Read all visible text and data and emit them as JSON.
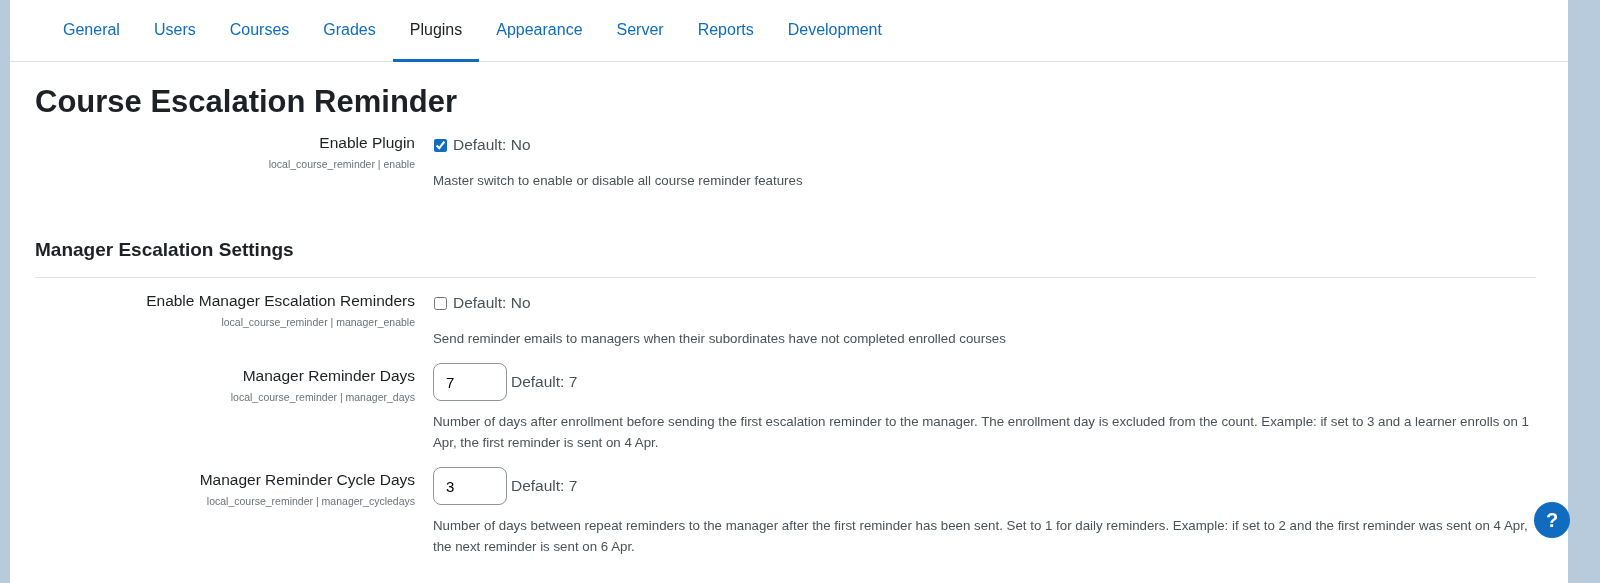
{
  "tabs": [
    {
      "label": "General",
      "selected": false
    },
    {
      "label": "Users",
      "selected": false
    },
    {
      "label": "Courses",
      "selected": false
    },
    {
      "label": "Grades",
      "selected": false
    },
    {
      "label": "Plugins",
      "selected": true
    },
    {
      "label": "Appearance",
      "selected": false
    },
    {
      "label": "Server",
      "selected": false
    },
    {
      "label": "Reports",
      "selected": false
    },
    {
      "label": "Development",
      "selected": false
    }
  ],
  "page_title": "Course Escalation Reminder",
  "sections": [
    {
      "settings": [
        {
          "kind": "checkbox",
          "label": "Enable Plugin",
          "key": "local_course_reminder | enable",
          "checked": true,
          "default": "Default: No",
          "description": "Master switch to enable or disable all course reminder features"
        }
      ]
    },
    {
      "heading": "Manager Escalation Settings",
      "settings": [
        {
          "kind": "checkbox",
          "label": "Enable Manager Escalation Reminders",
          "key": "local_course_reminder | manager_enable",
          "checked": false,
          "default": "Default: No",
          "description": "Send reminder emails to managers when their subordinates have not completed enrolled courses"
        },
        {
          "kind": "text",
          "label": "Manager Reminder Days",
          "key": "local_course_reminder | manager_days",
          "value": "7",
          "default": "Default: 7",
          "description": "Number of days after enrollment before sending the first escalation reminder to the manager. The enrollment day is excluded from the count. Example: if set to 3 and a learner enrolls on 1 Apr, the first reminder is sent on 4 Apr."
        },
        {
          "kind": "text",
          "label": "Manager Reminder Cycle Days",
          "key": "local_course_reminder | manager_cycledays",
          "value": "3",
          "default": "Default: 7",
          "description": "Number of days between repeat reminders to the manager after the first reminder has been sent. Set to 1 for daily reminders. Example: if set to 2 and the first reminder was sent on 4 Apr, the next reminder is sent on 6 Apr."
        }
      ]
    }
  ],
  "help_button": "?"
}
